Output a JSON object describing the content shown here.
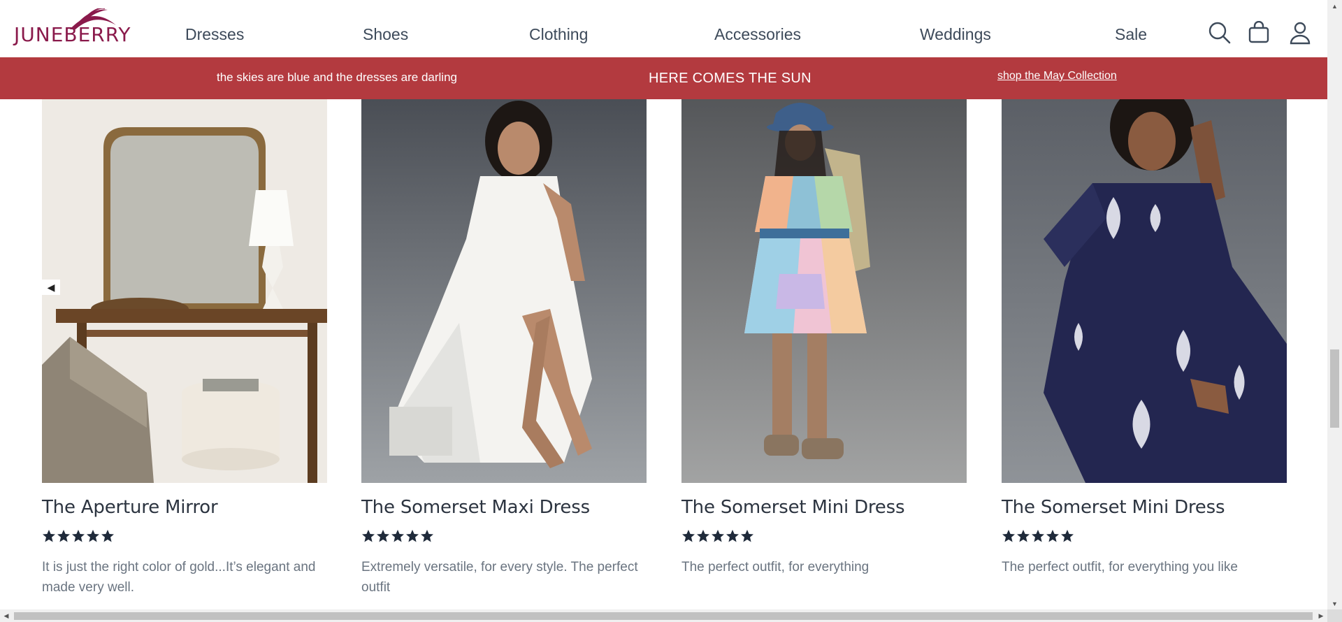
{
  "header": {
    "brand": "JUNEBERRY",
    "nav": [
      "Dresses",
      "Shoes",
      "Clothing",
      "Accessories",
      "Weddings",
      "Sale"
    ],
    "icons": [
      "search-icon",
      "shopping-bag-icon",
      "account-icon"
    ]
  },
  "promo": {
    "left_text": "the skies are blue and the dresses are darling",
    "center_text": "HERE COMES THE SUN",
    "link_text": "shop the May Collection",
    "background": "#b33a3f"
  },
  "products": [
    {
      "title": "The Aperture Mirror",
      "rating": 5,
      "review": "It is just the right color of gold...It’s elegant and made very well."
    },
    {
      "title": "The Somerset Maxi Dress",
      "rating": 5,
      "review": "Extremely versatile, for every style. The perfect outfit"
    },
    {
      "title": "The Somerset Mini Dress",
      "rating": 5,
      "review": "The perfect outfit, for everything"
    },
    {
      "title": "The Somerset Mini Dress",
      "rating": 5,
      "review": "The perfect outfit, for everything you like"
    }
  ],
  "carousel": {
    "prev_glyph": "◀"
  },
  "colors": {
    "brand": "#8a1a4b",
    "star": "#1f2a3a",
    "nav_text": "#3d4a5a"
  }
}
